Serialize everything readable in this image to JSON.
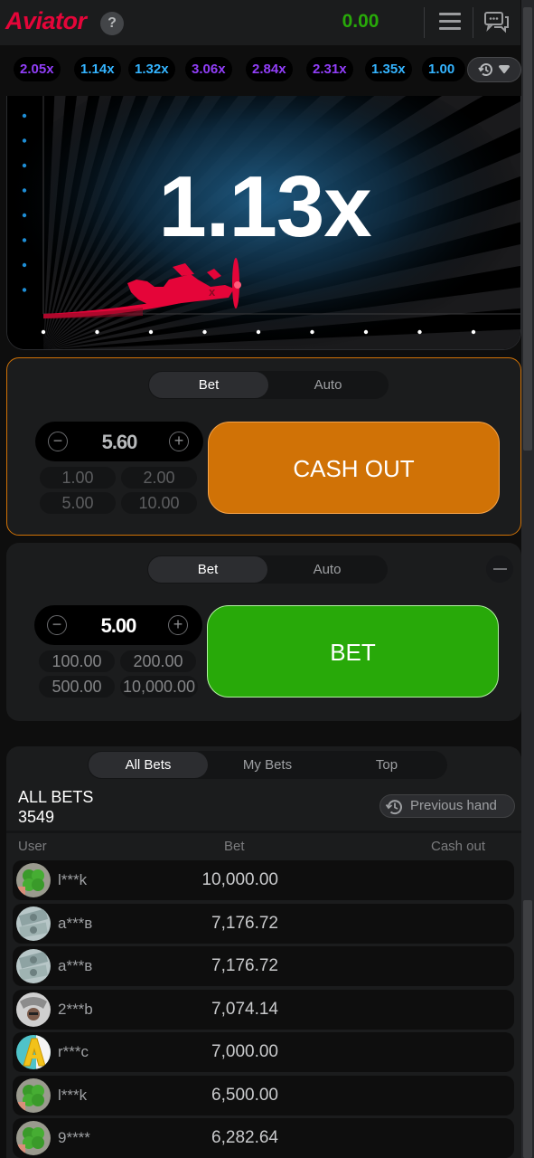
{
  "header": {
    "logo": "Aviator",
    "help_icon": "?",
    "balance": "0.00",
    "colors": {
      "logo": "#e50539",
      "balance": "#28a909"
    }
  },
  "history": {
    "multipliers": [
      {
        "value": "2.05x",
        "color": "#913ef8"
      },
      {
        "value": "1.14x",
        "color": "#34b4ff"
      },
      {
        "value": "1.32x",
        "color": "#34b4ff"
      },
      {
        "value": "3.06x",
        "color": "#913ef8"
      },
      {
        "value": "2.84x",
        "color": "#913ef8"
      },
      {
        "value": "2.31x",
        "color": "#913ef8"
      },
      {
        "value": "1.35x",
        "color": "#34b4ff"
      },
      {
        "value": "1.00",
        "color": "#34b4ff"
      }
    ]
  },
  "game": {
    "multiplier": "1.13x"
  },
  "panel1": {
    "tabs": [
      "Bet",
      "Auto"
    ],
    "active_tab": "Bet",
    "amount": "5.60",
    "quick": [
      "1.00",
      "2.00",
      "5.00",
      "10.00"
    ],
    "action": "CASH OUT",
    "action_color": "#d07206"
  },
  "panel2": {
    "tabs": [
      "Bet",
      "Auto"
    ],
    "active_tab": "Bet",
    "amount": "5.00",
    "quick": [
      "100.00",
      "200.00",
      "500.00",
      "10,000.00"
    ],
    "action": "BET",
    "action_color": "#28a909"
  },
  "bets": {
    "tabs": [
      "All Bets",
      "My Bets",
      "Top"
    ],
    "active_tab": "All Bets",
    "title": "ALL BETS",
    "count": "3549",
    "previous_hand": "Previous hand",
    "columns": [
      "User",
      "Bet",
      "Cash out"
    ],
    "rows": [
      {
        "user": "l***k",
        "bet": "10,000.00",
        "cash_out": "",
        "avatar": "clover"
      },
      {
        "user": "a***в",
        "bet": "7,176.72",
        "cash_out": "",
        "avatar": "money"
      },
      {
        "user": "a***в",
        "bet": "7,176.72",
        "cash_out": "",
        "avatar": "money"
      },
      {
        "user": "2***b",
        "bet": "7,074.14",
        "cash_out": "",
        "avatar": "person"
      },
      {
        "user": "r***c",
        "bet": "7,000.00",
        "cash_out": "",
        "avatar": "letter-a"
      },
      {
        "user": "l***k",
        "bet": "6,500.00",
        "cash_out": "",
        "avatar": "clover"
      },
      {
        "user": "9****",
        "bet": "6,282.64",
        "cash_out": "",
        "avatar": "clover"
      }
    ]
  }
}
